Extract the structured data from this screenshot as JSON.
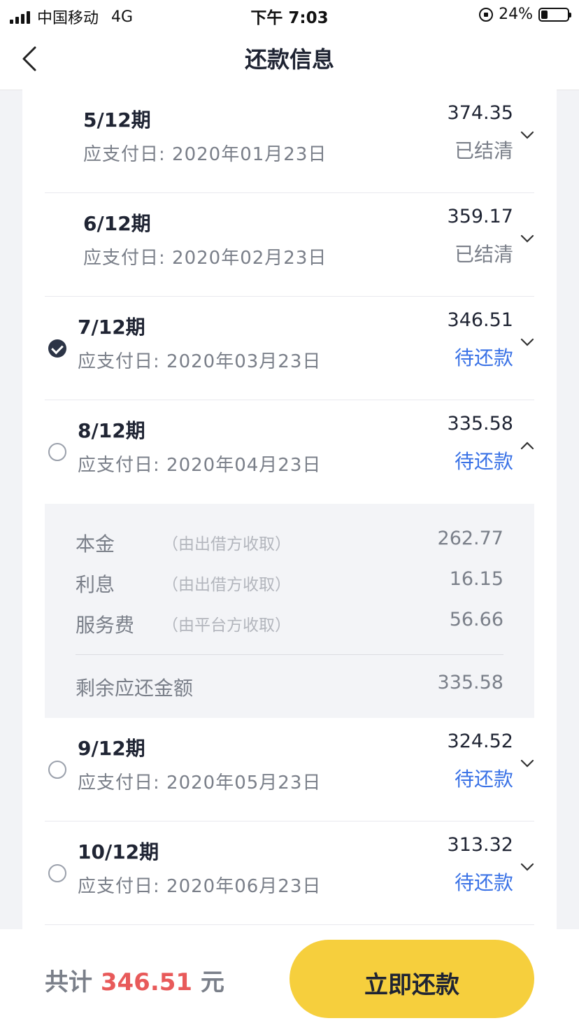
{
  "status_bar": {
    "carrier": "中国移动",
    "network": "4G",
    "time": "下午 7:03",
    "battery_pct": "24%",
    "battery_level": 0.24
  },
  "nav": {
    "title": "还款信息",
    "back_icon": "chevron-left-icon"
  },
  "installments": [
    {
      "period": "5/12期",
      "due_label": "应支付日:",
      "due_date": "2020年01月23日",
      "amount": "374.35",
      "status": "已结清",
      "state": "settled",
      "expanded": false
    },
    {
      "period": "6/12期",
      "due_label": "应支付日:",
      "due_date": "2020年02月23日",
      "amount": "359.17",
      "status": "已结清",
      "state": "settled",
      "expanded": false
    },
    {
      "period": "7/12期",
      "due_label": "应支付日:",
      "due_date": "2020年03月23日",
      "amount": "346.51",
      "status": "待还款",
      "state": "pending",
      "checked": true,
      "expanded": false
    },
    {
      "period": "8/12期",
      "due_label": "应支付日:",
      "due_date": "2020年04月23日",
      "amount": "335.58",
      "status": "待还款",
      "state": "pending",
      "checked": false,
      "expanded": true
    },
    {
      "period": "9/12期",
      "due_label": "应支付日:",
      "due_date": "2020年05月23日",
      "amount": "324.52",
      "status": "待还款",
      "state": "pending",
      "checked": false,
      "expanded": false
    },
    {
      "period": "10/12期",
      "due_label": "应支付日:",
      "due_date": "2020年06月23日",
      "amount": "313.32",
      "status": "待还款",
      "state": "pending",
      "checked": false,
      "expanded": false
    }
  ],
  "details": {
    "principal": {
      "label": "本金",
      "note": "（由出借方收取）",
      "value": "262.77"
    },
    "interest": {
      "label": "利息",
      "note": "（由出借方收取）",
      "value": "16.15"
    },
    "service_fee": {
      "label": "服务费",
      "note": "（由平台方收取）",
      "value": "56.66"
    },
    "remaining": {
      "label": "剩余应还金额",
      "value": "335.58"
    }
  },
  "footer": {
    "total_prefix": "共计",
    "total_amount": "346.51",
    "total_unit": "元",
    "pay_button": "立即还款"
  },
  "colors": {
    "accent_yellow": "#f6cf3d",
    "pending_blue": "#3a72e6",
    "total_red": "#e85a5a"
  }
}
